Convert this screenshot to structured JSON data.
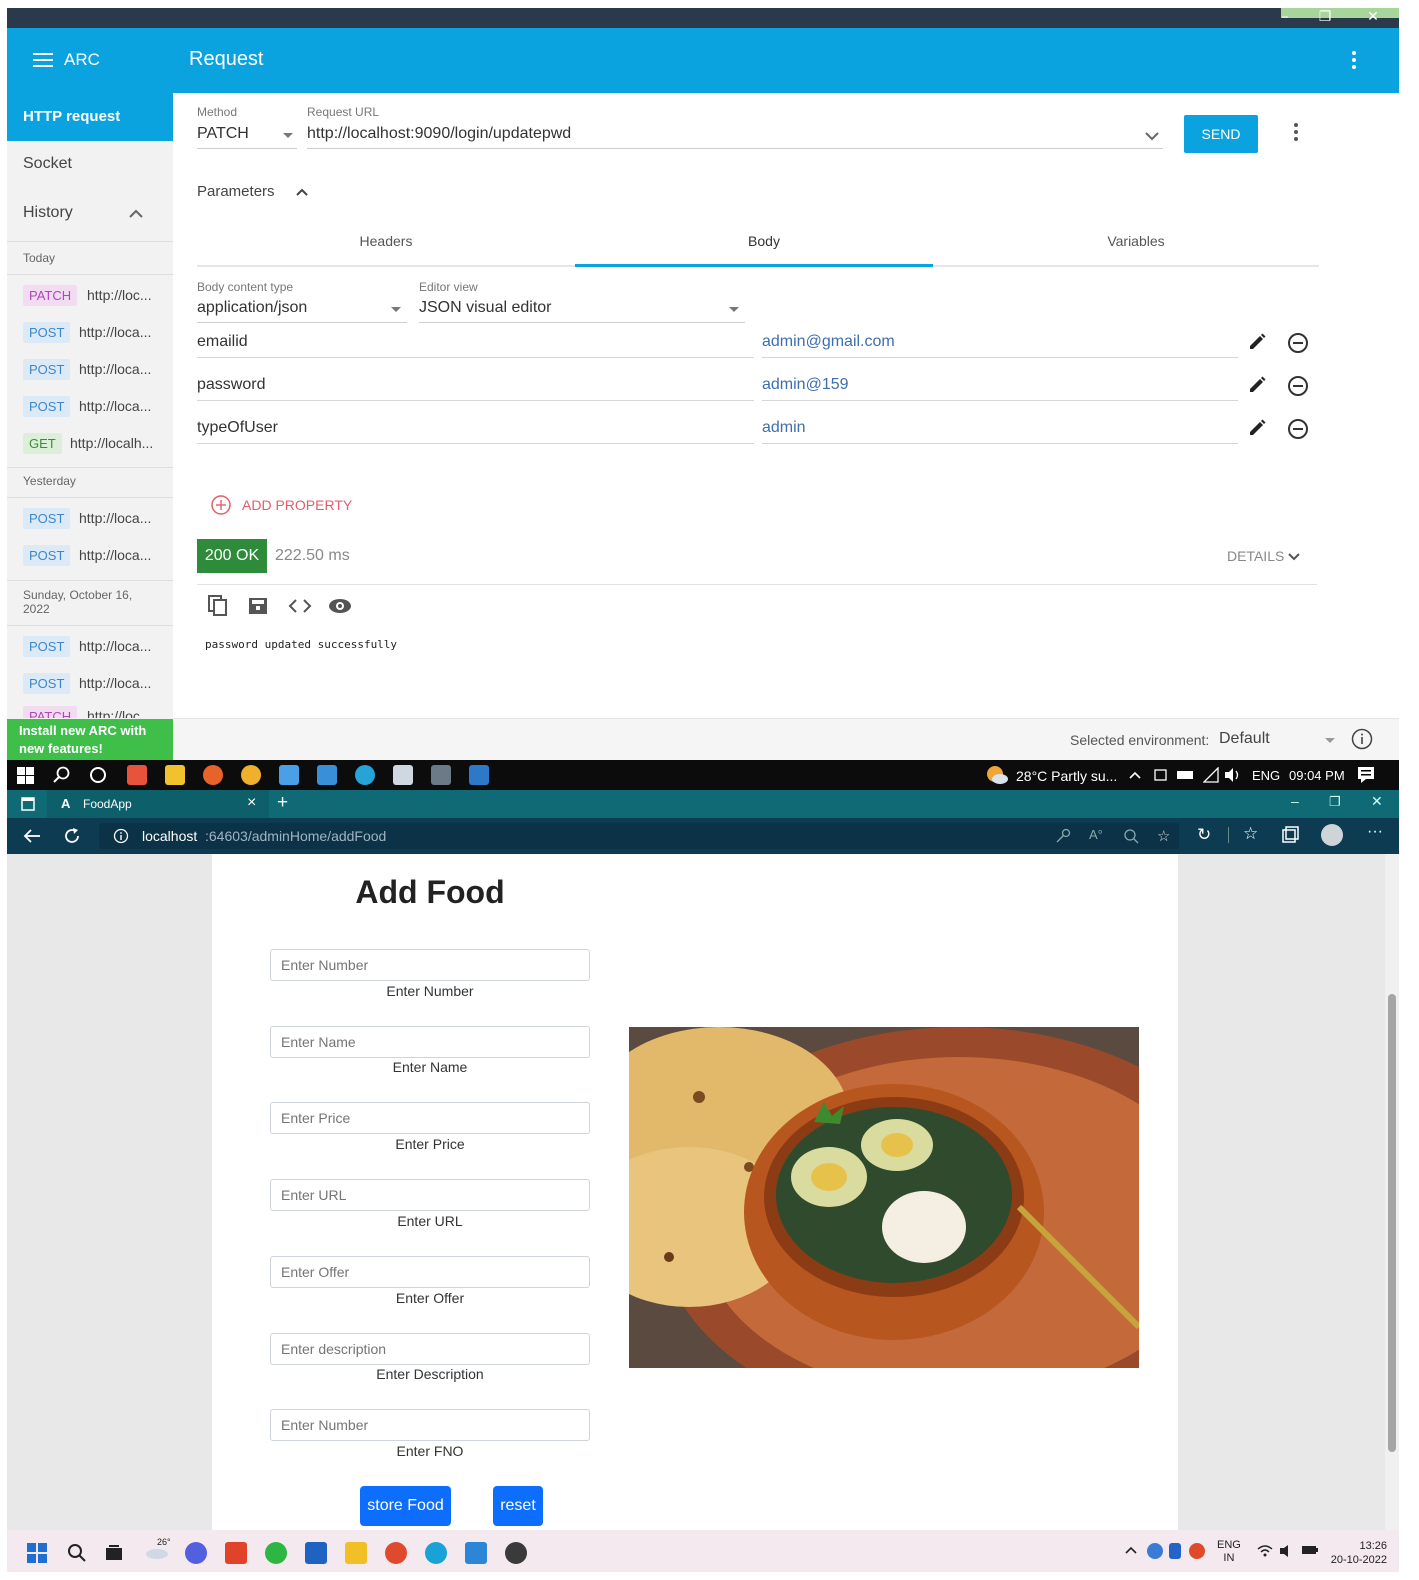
{
  "arc": {
    "window_controls": {
      "minimize": "–",
      "restore": "❐",
      "close": "✕"
    },
    "header": {
      "app_name": "ARC",
      "title": "Request"
    },
    "sidebar": {
      "nav": {
        "http_request": "HTTP request",
        "socket": "Socket",
        "history": "History"
      },
      "groups": {
        "today": "Today",
        "yesterday": "Yesterday",
        "older": "Sunday, October 16, 2022"
      },
      "today_items": [
        {
          "method": "PATCH",
          "url": "http://loc..."
        },
        {
          "method": "POST",
          "url": "http://loca..."
        },
        {
          "method": "POST",
          "url": "http://loca..."
        },
        {
          "method": "POST",
          "url": "http://loca..."
        },
        {
          "method": "GET",
          "url": "http://localh..."
        }
      ],
      "yesterday_items": [
        {
          "method": "POST",
          "url": "http://loca..."
        },
        {
          "method": "POST",
          "url": "http://loca..."
        }
      ],
      "older_items": [
        {
          "method": "POST",
          "url": "http://loca..."
        },
        {
          "method": "POST",
          "url": "http://loca..."
        },
        {
          "method": "PATCH",
          "url": "http://loc..."
        }
      ],
      "banner": "Install new ARC with new features!"
    },
    "request": {
      "method_label": "Method",
      "method": "PATCH",
      "url_label": "Request URL",
      "url": "http://localhost:9090/login/updatepwd",
      "send": "SEND",
      "parameters": "Parameters"
    },
    "tabs": [
      "Headers",
      "Body",
      "Variables"
    ],
    "active_tab": "Body",
    "body": {
      "content_type_label": "Body content type",
      "content_type": "application/json",
      "editor_view_label": "Editor view",
      "editor_view": "JSON visual editor",
      "properties": [
        {
          "key": "emailid",
          "value": "admin@gmail.com"
        },
        {
          "key": "password",
          "value": "admin@159"
        },
        {
          "key": "typeOfUser",
          "value": "admin"
        }
      ],
      "add_property": "ADD PROPERTY"
    },
    "response": {
      "status": "200 OK",
      "time": "222.50 ms",
      "details": "DETAILS",
      "body": "password updated successfully"
    },
    "footer": {
      "env_label": "Selected environment:",
      "env_value": "Default"
    }
  },
  "taskbar_top": {
    "weather": "28°C  Partly su...",
    "lang": "ENG",
    "time": "09:04 PM"
  },
  "browser": {
    "tab_title": "FoodApp",
    "tab_close": "×",
    "new_tab": "+",
    "url_host": "localhost",
    "url_path": ":64603/adminHome/addFood",
    "page": {
      "heading": "Add Food",
      "fields": [
        {
          "placeholder": "Enter Number",
          "caption": "Enter Number"
        },
        {
          "placeholder": "Enter Name",
          "caption": "Enter Name"
        },
        {
          "placeholder": "Enter Price",
          "caption": "Enter Price"
        },
        {
          "placeholder": "Enter URL",
          "caption": "Enter URL"
        },
        {
          "placeholder": "Enter Offer",
          "caption": "Enter Offer"
        },
        {
          "placeholder": "Enter description",
          "caption": "Enter Description"
        },
        {
          "placeholder": "Enter Number",
          "caption": "Enter FNO"
        }
      ],
      "store_button": "store Food",
      "reset_button": "reset"
    }
  },
  "taskbar_bottom": {
    "temp_badge": "26°",
    "lang_top": "ENG",
    "lang_bottom": "IN",
    "time": "13:26",
    "date": "20-10-2022"
  },
  "colors": {
    "arc_header": "#0aa3df",
    "arc_accent": "#0aa3df",
    "status_ok": "#2e8b3a",
    "add_property": "#e35d6a",
    "bootstrap_primary": "#0d6efd"
  }
}
